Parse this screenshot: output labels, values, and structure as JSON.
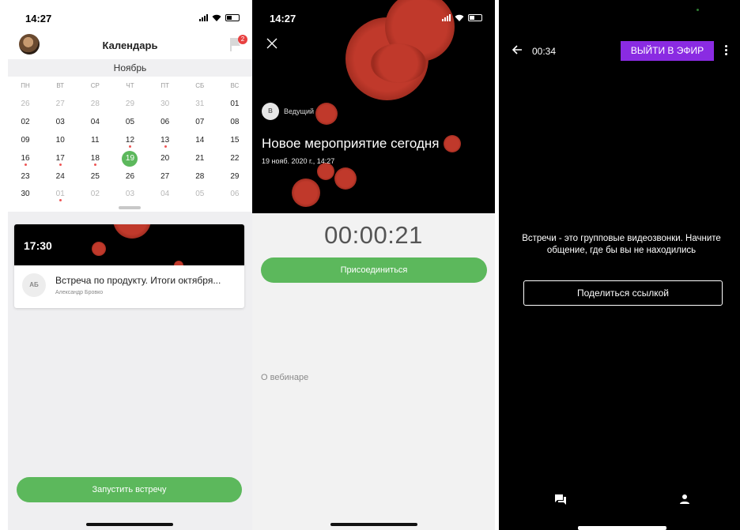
{
  "calendar_screen": {
    "status_time": "14:27",
    "title": "Календарь",
    "notification_count": "2",
    "month": "Ноябрь",
    "weekdays": [
      "ПН",
      "ВТ",
      "СР",
      "ЧТ",
      "ПТ",
      "СБ",
      "ВС"
    ],
    "weeks": [
      [
        "26",
        "27",
        "28",
        "29",
        "30",
        "31",
        "01"
      ],
      [
        "02",
        "03",
        "04",
        "05",
        "06",
        "07",
        "08"
      ],
      [
        "09",
        "10",
        "11",
        "12",
        "13",
        "14",
        "15"
      ],
      [
        "16",
        "17",
        "18",
        "19",
        "20",
        "21",
        "22"
      ],
      [
        "23",
        "24",
        "25",
        "26",
        "27",
        "28",
        "29"
      ],
      [
        "30",
        "01",
        "02",
        "03",
        "04",
        "05",
        "06"
      ]
    ],
    "selected_day": "19",
    "event": {
      "time": "17:30",
      "initials": "АБ",
      "name": "Встреча по продукту. Итоги октября...",
      "host": "Александр Бровко"
    },
    "start_button": "Запустить встречу",
    "accent_color": "#5cb85c"
  },
  "event_screen": {
    "status_time": "14:27",
    "host_initial": "В",
    "host_label": "Ведущий",
    "title": "Новое мероприятие сегодня",
    "datetime": "19 нояб. 2020 г., 14:27",
    "timer": "00:00:21",
    "join_button": "Присоединиться",
    "about_label": "О вебинаре"
  },
  "broadcast_screen": {
    "elapsed": "00:34",
    "live_button": "ВЫЙТИ В ЭФИР",
    "live_color": "#8a2be2",
    "message": "Встречи - это групповые видеозвонки. Начните общение, где бы вы не находились",
    "share_button": "Поделиться ссылкой",
    "icons": [
      "back-arrow-icon",
      "more-vertical-icon",
      "chat-icon",
      "person-icon"
    ]
  }
}
